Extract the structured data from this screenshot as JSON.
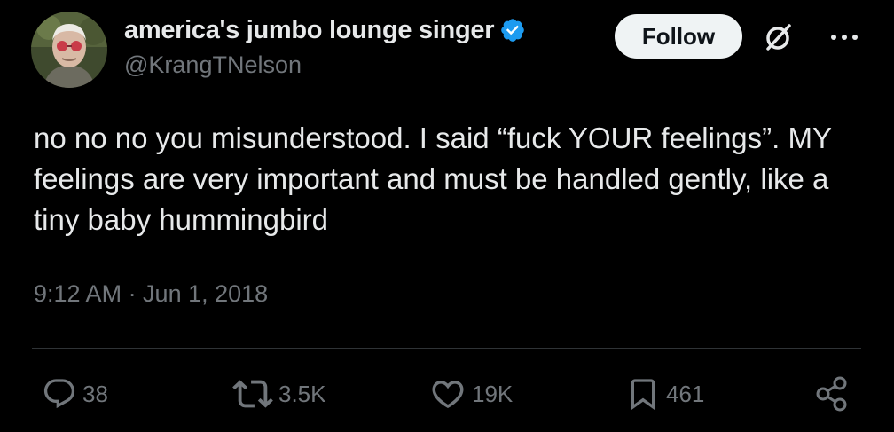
{
  "tweet": {
    "author": {
      "display_name": "america's jumbo lounge singer",
      "handle": "@KrangTNelson",
      "verified": true
    },
    "follow_label": "Follow",
    "text": "no no no you misunderstood. I said “fuck YOUR feelings”. MY feelings are very important and must be handled gently, like a tiny baby hummingbird",
    "timestamp": "9:12 AM · Jun 1, 2018",
    "stats": {
      "replies": "38",
      "reposts": "3.5K",
      "likes": "19K",
      "bookmarks": "461"
    }
  },
  "icons": {
    "verified": "verified-badge-icon",
    "grok": "grok-icon",
    "more": "more-options-icon",
    "reply": "reply-icon",
    "repost": "repost-icon",
    "like": "heart-icon",
    "bookmark": "bookmark-icon",
    "share": "share-icon"
  },
  "colors": {
    "background": "#000000",
    "text_primary": "#e7e9ea",
    "text_secondary": "#71767b",
    "verified_blue": "#1d9bf0",
    "follow_button_bg": "#eff3f4",
    "divider": "#2f3336"
  }
}
